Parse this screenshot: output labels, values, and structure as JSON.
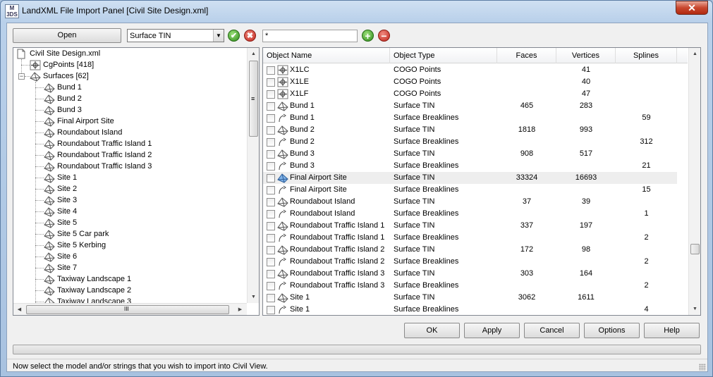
{
  "window": {
    "title": "LandXML File Import Panel [Civil Site Design.xml]",
    "icon_text": "M\n3DS",
    "close_glyph": "✕"
  },
  "toolbar": {
    "open_label": "Open",
    "type_select": {
      "value": "Surface TIN",
      "arrow": "▼"
    },
    "accept_glyph": "✔",
    "reject_glyph": "✖",
    "filter_value": "*",
    "add_glyph": "+",
    "remove_glyph": "−"
  },
  "tree": {
    "root": "Civil Site Design.xml",
    "cgpoints": "CgPoints [418]",
    "surfaces": "Surfaces [62]",
    "surface_items": [
      "Bund 1",
      "Bund 2",
      "Bund 3",
      "Final Airport Site",
      "Roundabout Island",
      "Roundabout Traffic Island 1",
      "Roundabout Traffic Island 2",
      "Roundabout Traffic Island 3",
      "Site 1",
      "Site 2",
      "Site 3",
      "Site 4",
      "Site 5",
      "Site 5 Car park",
      "Site 5 Kerbing",
      "Site 6",
      "Site 7",
      "Taxiway Landscape 1",
      "Taxiway Landscape 2",
      "Taxiway Landscape 3"
    ],
    "grip_glyph": "≡",
    "hgrip_glyph": "III"
  },
  "table": {
    "headers": [
      "Object Name",
      "Object Type",
      "Faces",
      "Vertices",
      "Splines"
    ],
    "rows": [
      {
        "icon": "cogo",
        "name": "X1LC",
        "type": "COGO Points",
        "faces": "",
        "vertices": "41",
        "splines": ""
      },
      {
        "icon": "cogo",
        "name": "X1LE",
        "type": "COGO Points",
        "faces": "",
        "vertices": "40",
        "splines": ""
      },
      {
        "icon": "cogo",
        "name": "X1LF",
        "type": "COGO Points",
        "faces": "",
        "vertices": "47",
        "splines": ""
      },
      {
        "icon": "tin",
        "name": "Bund 1",
        "type": "Surface TIN",
        "faces": "465",
        "vertices": "283",
        "splines": ""
      },
      {
        "icon": "brk",
        "name": "Bund 1",
        "type": "Surface Breaklines",
        "faces": "",
        "vertices": "",
        "splines": "59"
      },
      {
        "icon": "tin",
        "name": "Bund 2",
        "type": "Surface TIN",
        "faces": "1818",
        "vertices": "993",
        "splines": ""
      },
      {
        "icon": "brk",
        "name": "Bund 2",
        "type": "Surface Breaklines",
        "faces": "",
        "vertices": "",
        "splines": "312"
      },
      {
        "icon": "tin",
        "name": "Bund 3",
        "type": "Surface TIN",
        "faces": "908",
        "vertices": "517",
        "splines": ""
      },
      {
        "icon": "brk",
        "name": "Bund 3",
        "type": "Surface Breaklines",
        "faces": "",
        "vertices": "",
        "splines": "21"
      },
      {
        "icon": "tin-blue",
        "name": "Final Airport Site",
        "type": "Surface TIN",
        "faces": "33324",
        "vertices": "16693",
        "splines": ""
      },
      {
        "icon": "brk",
        "name": "Final Airport Site",
        "type": "Surface Breaklines",
        "faces": "",
        "vertices": "",
        "splines": "15"
      },
      {
        "icon": "tin",
        "name": "Roundabout Island",
        "type": "Surface TIN",
        "faces": "37",
        "vertices": "39",
        "splines": ""
      },
      {
        "icon": "brk",
        "name": "Roundabout Island",
        "type": "Surface Breaklines",
        "faces": "",
        "vertices": "",
        "splines": "1"
      },
      {
        "icon": "tin",
        "name": "Roundabout Traffic Island 1",
        "type": "Surface TIN",
        "faces": "337",
        "vertices": "197",
        "splines": ""
      },
      {
        "icon": "brk",
        "name": "Roundabout Traffic Island 1",
        "type": "Surface Breaklines",
        "faces": "",
        "vertices": "",
        "splines": "2"
      },
      {
        "icon": "tin",
        "name": "Roundabout Traffic Island 2",
        "type": "Surface TIN",
        "faces": "172",
        "vertices": "98",
        "splines": ""
      },
      {
        "icon": "brk",
        "name": "Roundabout Traffic Island 2",
        "type": "Surface Breaklines",
        "faces": "",
        "vertices": "",
        "splines": "2"
      },
      {
        "icon": "tin",
        "name": "Roundabout Traffic Island 3",
        "type": "Surface TIN",
        "faces": "303",
        "vertices": "164",
        "splines": ""
      },
      {
        "icon": "brk",
        "name": "Roundabout Traffic Island 3",
        "type": "Surface Breaklines",
        "faces": "",
        "vertices": "",
        "splines": "2"
      },
      {
        "icon": "tin",
        "name": "Site 1",
        "type": "Surface TIN",
        "faces": "3062",
        "vertices": "1611",
        "splines": ""
      },
      {
        "icon": "brk",
        "name": "Site 1",
        "type": "Surface Breaklines",
        "faces": "",
        "vertices": "",
        "splines": "4"
      }
    ]
  },
  "buttons": {
    "ok": "OK",
    "apply": "Apply",
    "cancel": "Cancel",
    "options": "Options",
    "help": "Help"
  },
  "status": "Now select the model and/or strings that you wish to import into Civil View.",
  "scroll": {
    "up": "▲",
    "down": "▼",
    "left": "◀",
    "right": "▶"
  }
}
